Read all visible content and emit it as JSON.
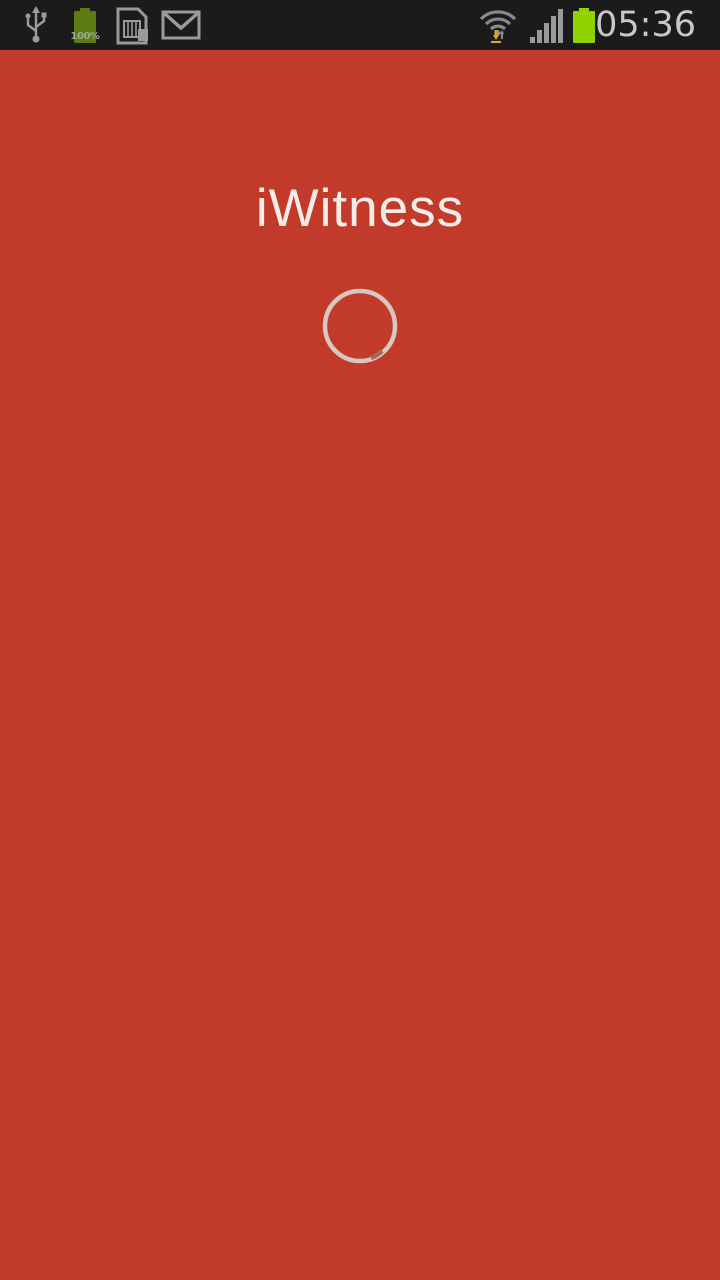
{
  "status_bar": {
    "time": "05:36",
    "battery_percent_label": "100%",
    "notification_icons": [
      "usb-icon",
      "battery-full-icon",
      "sd-card-icon",
      "gmail-icon"
    ],
    "system_icons": [
      "wifi-icon",
      "signal-icon",
      "battery-icon"
    ],
    "battery_level": 1.0
  },
  "app": {
    "title": "iWitness",
    "background_color": "#c23b2a",
    "loading": true
  }
}
